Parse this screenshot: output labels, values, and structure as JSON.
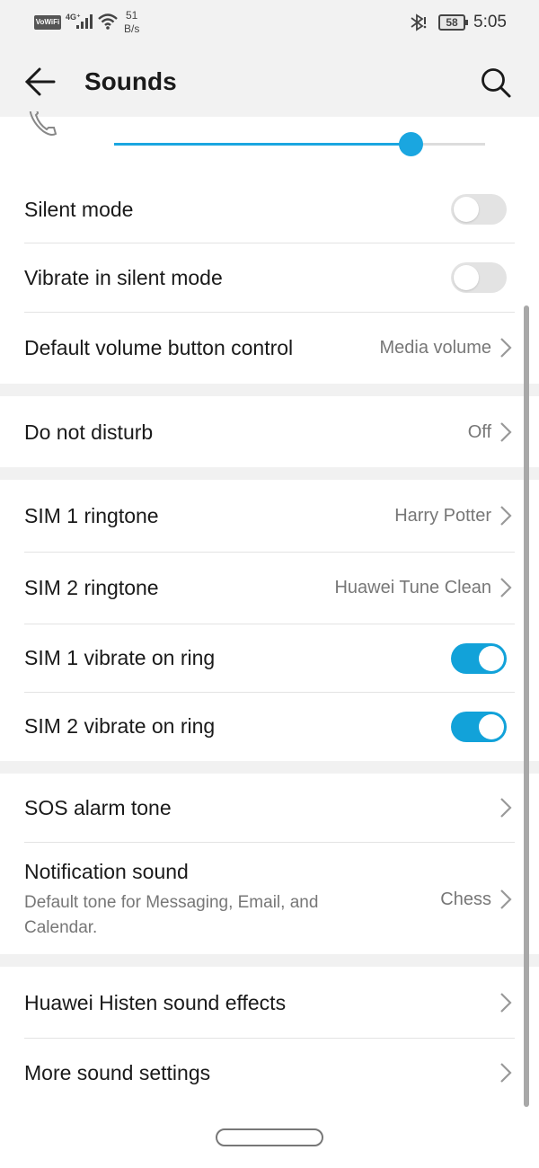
{
  "status_bar": {
    "vowifi": "VoWiFi",
    "network": "4G⁺",
    "speed_value": "51",
    "speed_unit": "B/s",
    "battery": "58",
    "time": "5:05"
  },
  "header": {
    "title": "Sounds",
    "back_icon": "arrow-left-icon",
    "search_icon": "search-icon"
  },
  "ringer_volume": {
    "icon": "phone-icon",
    "level": 0.8
  },
  "settings": {
    "silent_mode": {
      "title": "Silent mode",
      "enabled": false
    },
    "vibrate_silent": {
      "title": "Vibrate in silent mode",
      "enabled": false
    },
    "default_volume": {
      "title": "Default volume button control",
      "value": "Media volume"
    },
    "dnd": {
      "title": "Do not disturb",
      "value": "Off"
    },
    "sim1_ringtone": {
      "title": "SIM 1 ringtone",
      "value": "Harry Potter"
    },
    "sim2_ringtone": {
      "title": "SIM 2 ringtone",
      "value": "Huawei Tune Clean"
    },
    "sim1_vibrate": {
      "title": "SIM 1 vibrate on ring",
      "enabled": true
    },
    "sim2_vibrate": {
      "title": "SIM 2 vibrate on ring",
      "enabled": true
    },
    "sos_tone": {
      "title": "SOS alarm tone"
    },
    "notification_sound": {
      "title": "Notification sound",
      "subtitle": "Default tone for Messaging, Email, and Calendar.",
      "value": "Chess"
    },
    "histen": {
      "title": "Huawei Histen sound effects"
    },
    "more_sound": {
      "title": "More sound settings"
    }
  },
  "colors": {
    "accent": "#12a2d9",
    "toggle_off": "#e3e3e3",
    "header_bg": "#f2f2f2"
  }
}
